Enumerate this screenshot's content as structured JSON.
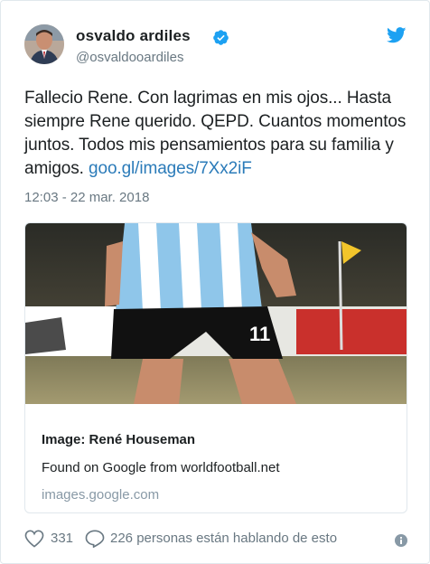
{
  "user": {
    "name": "osvaldo ardiles",
    "handle": "@osvaldooardiles",
    "verified_icon": "verified-badge-icon",
    "brand_color": "#1da1f2"
  },
  "tweet": {
    "text": "Fallecio Rene. Con lagrimas en mis ojos... Hasta siempre Rene querido. QEPD. Cuantos momentos juntos. Todos mis pensamientos para su familia y amigos. ",
    "link_text": "goo.gl/images/7Xx2iF",
    "timestamp": "12:03 - 22 mar. 2018"
  },
  "card": {
    "title": "Image: René Houseman",
    "description": "Found on Google from worldfootball.net",
    "domain": "images.google.com",
    "image_icon": "football-photo"
  },
  "actions": {
    "like_count": "331",
    "conversation": "226 personas están hablando de esto",
    "like_icon": "heart-icon",
    "reply_icon": "reply-icon",
    "info_icon": "info-icon"
  }
}
